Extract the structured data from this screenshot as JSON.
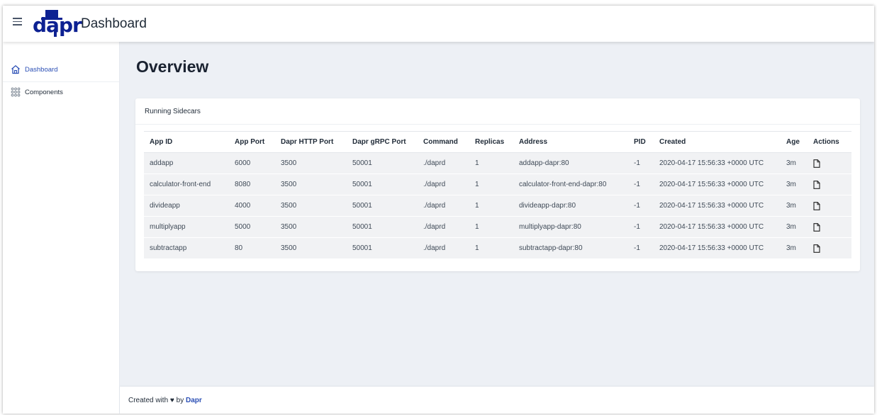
{
  "header": {
    "logo_text": "dapr",
    "title": "Dashboard",
    "brand_color": "#0d2192"
  },
  "sidebar": {
    "items": [
      {
        "label": "Dashboard",
        "icon": "home-icon",
        "active": true
      },
      {
        "label": "Components",
        "icon": "grid-icon",
        "active": false
      }
    ]
  },
  "main": {
    "page_title": "Overview",
    "card_title": "Running Sidecars",
    "columns": [
      "App ID",
      "App Port",
      "Dapr HTTP Port",
      "Dapr gRPC Port",
      "Command",
      "Replicas",
      "Address",
      "PID",
      "Created",
      "Age",
      "Actions"
    ],
    "rows": [
      {
        "app_id": "addapp",
        "app_port": "6000",
        "http_port": "3500",
        "grpc_port": "50001",
        "command": "./daprd",
        "replicas": "1",
        "address": "addapp-dapr:80",
        "pid": "-1",
        "created": "2020-04-17 15:56:33 +0000 UTC",
        "age": "3m",
        "action_icon": "document-icon"
      },
      {
        "app_id": "calculator-front-end",
        "app_port": "8080",
        "http_port": "3500",
        "grpc_port": "50001",
        "command": "./daprd",
        "replicas": "1",
        "address": "calculator-front-end-dapr:80",
        "pid": "-1",
        "created": "2020-04-17 15:56:33 +0000 UTC",
        "age": "3m",
        "action_icon": "document-icon"
      },
      {
        "app_id": "divideapp",
        "app_port": "4000",
        "http_port": "3500",
        "grpc_port": "50001",
        "command": "./daprd",
        "replicas": "1",
        "address": "divideapp-dapr:80",
        "pid": "-1",
        "created": "2020-04-17 15:56:33 +0000 UTC",
        "age": "3m",
        "action_icon": "document-icon"
      },
      {
        "app_id": "multiplyapp",
        "app_port": "5000",
        "http_port": "3500",
        "grpc_port": "50001",
        "command": "./daprd",
        "replicas": "1",
        "address": "multiplyapp-dapr:80",
        "pid": "-1",
        "created": "2020-04-17 15:56:33 +0000 UTC",
        "age": "3m",
        "action_icon": "document-icon"
      },
      {
        "app_id": "subtractapp",
        "app_port": "80",
        "http_port": "3500",
        "grpc_port": "50001",
        "command": "./daprd",
        "replicas": "1",
        "address": "subtractapp-dapr:80",
        "pid": "-1",
        "created": "2020-04-17 15:56:33 +0000 UTC",
        "age": "3m",
        "action_icon": "document-icon"
      }
    ]
  },
  "footer": {
    "prefix": "Created with",
    "heart": "♥",
    "by": "by",
    "link": "Dapr"
  }
}
